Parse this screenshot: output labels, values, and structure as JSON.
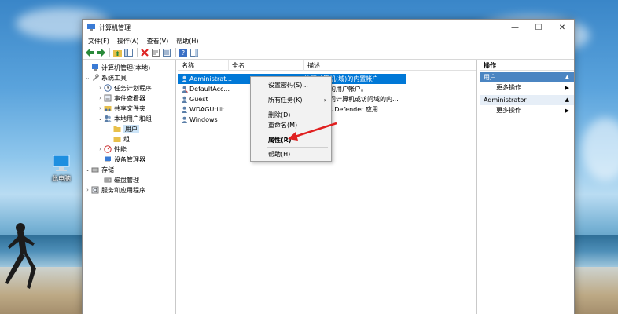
{
  "desktop": {
    "icon_label": "此电脑"
  },
  "window": {
    "title": "计算机管理",
    "minimize_glyph": "—",
    "maximize_glyph": "☐",
    "close_glyph": "✕"
  },
  "menubar": [
    "文件(F)",
    "操作(A)",
    "查看(V)",
    "帮助(H)"
  ],
  "tree": [
    {
      "label": "计算机管理(本地)",
      "exp": ""
    },
    {
      "label": "系统工具",
      "exp": "⌄"
    },
    {
      "label": "任务计划程序",
      "exp": "›"
    },
    {
      "label": "事件查看器",
      "exp": "›"
    },
    {
      "label": "共享文件夹",
      "exp": "›"
    },
    {
      "label": "本地用户和组",
      "exp": "⌄"
    },
    {
      "label": "用户",
      "exp": ""
    },
    {
      "label": "组",
      "exp": ""
    },
    {
      "label": "性能",
      "exp": "›"
    },
    {
      "label": "设备管理器",
      "exp": ""
    },
    {
      "label": "存储",
      "exp": "⌄"
    },
    {
      "label": "磁盘管理",
      "exp": ""
    },
    {
      "label": "服务和应用程序",
      "exp": "›"
    }
  ],
  "list": {
    "columns": [
      "名称",
      "全名",
      "描述"
    ],
    "rows": [
      {
        "name": "Administrat...",
        "full": "",
        "desc": "管理计算机(域)的内置帐户"
      },
      {
        "name": "DefaultAcc...",
        "full": "",
        "desc": "系统管理的用户帐户。"
      },
      {
        "name": "Guest",
        "full": "",
        "desc": "供来宾访问计算机或访问域的内..."
      },
      {
        "name": "WDAGUtilit...",
        "full": "",
        "desc": "Windows Defender 应用..."
      },
      {
        "name": "Windows",
        "full": "",
        "desc": ""
      }
    ]
  },
  "actions": {
    "title": "操作",
    "sections": [
      {
        "label": "用户",
        "more": "更多操作"
      },
      {
        "label": "Administrator",
        "more": "更多操作"
      }
    ]
  },
  "context_menu": {
    "set_password": "设置密码(S)...",
    "all_tasks": "所有任务(K)",
    "delete": "删除(D)",
    "rename": "重命名(M)",
    "properties": "属性(R)",
    "help": "帮助(H)"
  },
  "colors": {
    "selection": "#0078d7",
    "annotation_arrow": "#e02020"
  }
}
